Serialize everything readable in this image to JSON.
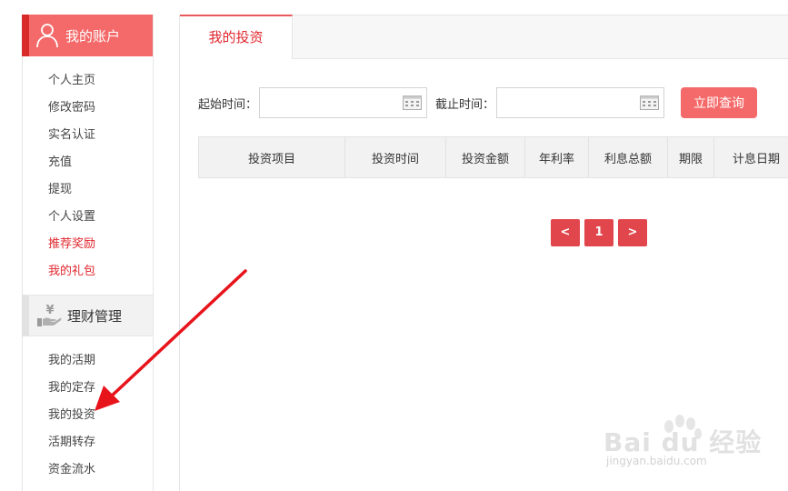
{
  "sidebar": {
    "account": {
      "title": "我的账户",
      "icon": "user-icon",
      "items": [
        {
          "label": "个人主页",
          "red": false
        },
        {
          "label": "修改密码",
          "red": false
        },
        {
          "label": "实名认证",
          "red": false
        },
        {
          "label": "充值",
          "red": false
        },
        {
          "label": "提现",
          "red": false
        },
        {
          "label": "个人设置",
          "red": false
        },
        {
          "label": "推荐奖励",
          "red": true
        },
        {
          "label": "我的礼包",
          "red": true
        }
      ]
    },
    "finance": {
      "title": "理财管理",
      "icon": "yen-hand-icon",
      "items": [
        {
          "label": "我的活期"
        },
        {
          "label": "我的定存"
        },
        {
          "label": "我的投资"
        },
        {
          "label": "活期转存"
        },
        {
          "label": "资金流水"
        }
      ]
    }
  },
  "main": {
    "tab": "我的投资",
    "filter": {
      "start_label": "起始时间：",
      "end_label": "截止时间：",
      "start_value": "",
      "end_value": "",
      "query_button": "立即查询"
    },
    "table": {
      "headers": [
        "投资项目",
        "投资时间",
        "投资金额",
        "年利率",
        "利息总额",
        "期限",
        "计息日期"
      ]
    },
    "pager": {
      "prev": "<",
      "page": "1",
      "next": ">"
    }
  },
  "watermark": {
    "brand": "Bai du 经验",
    "url": "jingyan.baidu.com"
  },
  "colors": {
    "accent": "#f46a6a",
    "accent_dark": "#d92a2a",
    "link_red": "#e0262d",
    "pager_red": "#e0464b",
    "arrow": "#e8141c"
  }
}
